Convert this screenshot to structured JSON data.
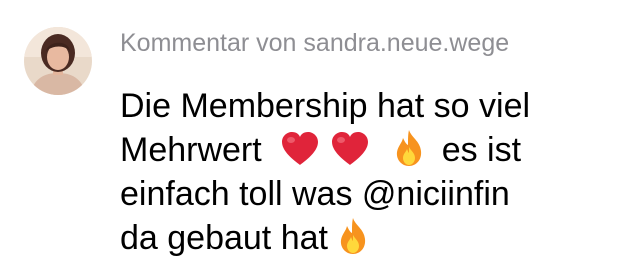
{
  "comment": {
    "header": "Kommentar von sandra.neue.wege",
    "line1": "Die Membership hat so viel",
    "line2_text": "Mehrwert",
    "line2_tail": "es ist",
    "line3": "einfach toll was @niciinfin",
    "line4": "da gebaut hat"
  },
  "icons": {
    "avatar": "profile-photo",
    "heart": "red-heart-emoji",
    "fire": "fire-emoji"
  },
  "colors": {
    "header_text": "#8e8e93",
    "body_text": "#000000",
    "heart": "#e0243a",
    "fire_outer": "#f7931e",
    "fire_inner": "#ffd83b"
  }
}
